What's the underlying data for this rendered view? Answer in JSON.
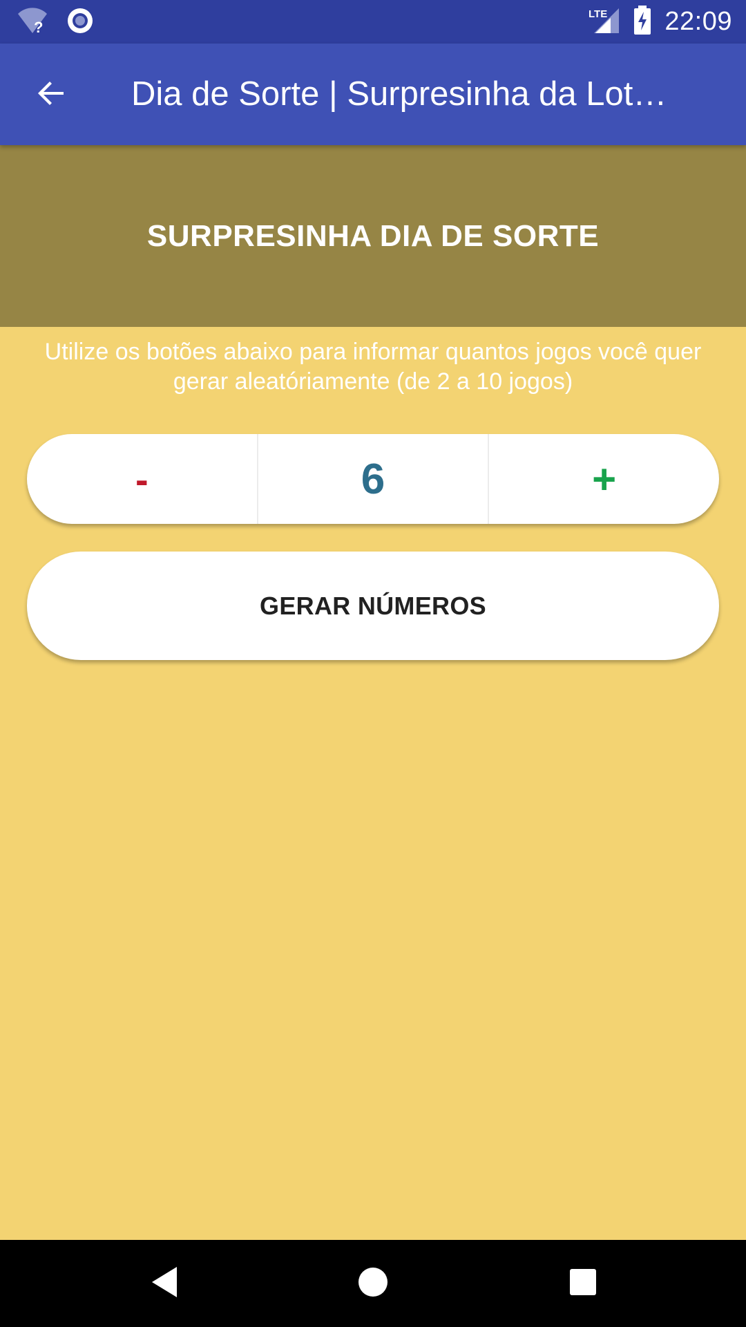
{
  "status_bar": {
    "time": "22:09",
    "network_label": "LTE",
    "icons": [
      "wifi-unknown-icon",
      "record-icon",
      "lte-signal-icon",
      "battery-charging-icon"
    ]
  },
  "app_bar": {
    "title": "Dia de Sorte | Surpresinha da Lot…",
    "back_icon": "arrow-back-icon"
  },
  "header": {
    "title": "SURPRESINHA DIA DE SORTE"
  },
  "instructions": {
    "line1": "Utilize os botões abaixo para informar quantos jogos você quer",
    "line2": "gerar aleatóriamente (de 2 a 10 jogos)"
  },
  "stepper": {
    "minus_label": "-",
    "value": "6",
    "plus_label": "+"
  },
  "generate_button": {
    "label": "GERAR NÚMEROS"
  },
  "nav_bar": {
    "icons": [
      "back-triangle-icon",
      "home-circle-icon",
      "recents-square-icon"
    ]
  },
  "colors": {
    "status_bar": "#2F3E9E",
    "app_bar": "#3F51B5",
    "header_band": "#968545",
    "background": "#F3D372",
    "minus": "#C0192B",
    "value": "#2D6E8C",
    "plus": "#18A34C"
  }
}
